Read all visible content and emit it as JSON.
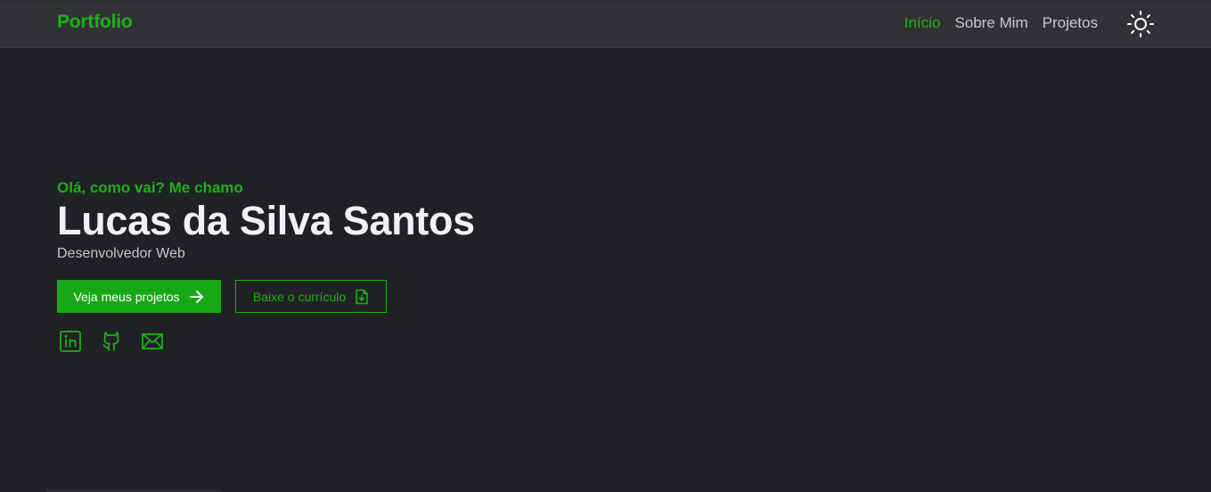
{
  "navbar": {
    "brand": "Portfolio",
    "links": [
      {
        "label": "Início",
        "active": true
      },
      {
        "label": "Sobre Mim",
        "active": false
      },
      {
        "label": "Projetos",
        "active": false
      }
    ],
    "theme_toggle_icon": "sun-icon"
  },
  "hero": {
    "greeting": "Olá, como vai? Me chamo",
    "name": "Lucas da Silva Santos",
    "role": "Desenvolvedor Web",
    "primary_button": {
      "label": "Veja meus projetos",
      "icon": "arrow-right-icon"
    },
    "secondary_button": {
      "label": "Baixe o currículo",
      "icon": "file-download-icon"
    },
    "socials": [
      {
        "icon": "linkedin-icon"
      },
      {
        "icon": "github-icon"
      },
      {
        "icon": "mail-icon"
      }
    ]
  },
  "colors": {
    "accent": "#1fb01a",
    "background": "#202125",
    "navbar": "#313235",
    "text_primary": "#f1f1f3",
    "text_secondary": "#c4c5c8"
  }
}
